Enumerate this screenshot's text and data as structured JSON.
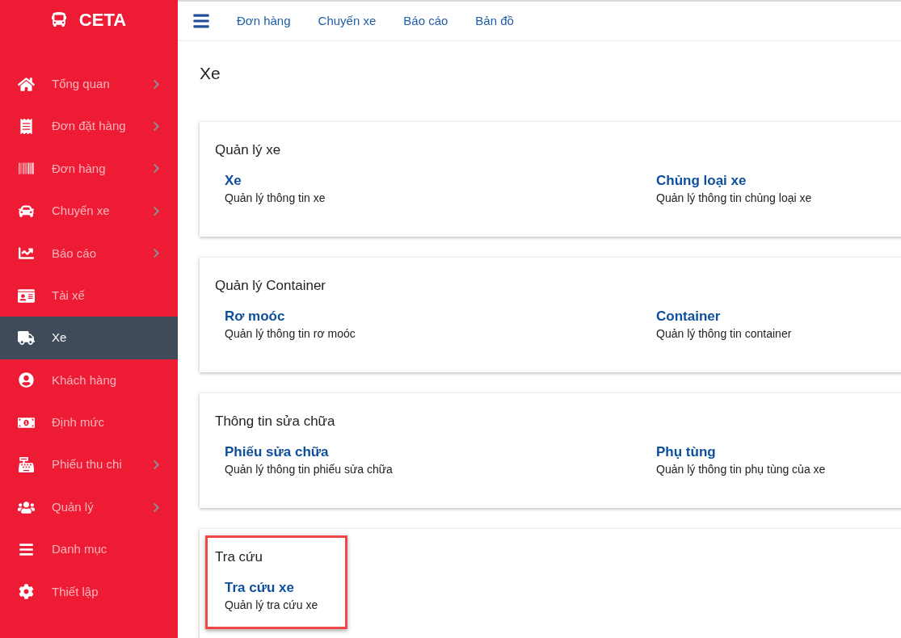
{
  "sidebar": {
    "logo": "CETA",
    "items": [
      {
        "label": "Tổng quan",
        "selected": false,
        "has_submenu": true
      },
      {
        "label": "Đơn đặt hàng",
        "selected": false,
        "has_submenu": true
      },
      {
        "label": "Đơn hàng",
        "selected": false,
        "has_submenu": true
      },
      {
        "label": "Chuyến xe",
        "selected": false,
        "has_submenu": true
      },
      {
        "label": "Báo cáo",
        "selected": false,
        "has_submenu": true
      },
      {
        "label": "Tài xế",
        "selected": false,
        "has_submenu": false
      },
      {
        "label": "Xe",
        "selected": true,
        "has_submenu": false
      },
      {
        "label": "Khách hàng",
        "selected": false,
        "has_submenu": false
      },
      {
        "label": "Định mức",
        "selected": false,
        "has_submenu": false
      },
      {
        "label": "Phiếu thu chi",
        "selected": false,
        "has_submenu": true
      },
      {
        "label": "Quản lý",
        "selected": false,
        "has_submenu": true
      },
      {
        "label": "Danh mục",
        "selected": false,
        "has_submenu": false
      },
      {
        "label": "Thiết lập",
        "selected": false,
        "has_submenu": false
      }
    ]
  },
  "top_nav": {
    "links": [
      "Đơn hàng",
      "Chuyến xe",
      "Báo cáo",
      "Bản đồ"
    ]
  },
  "page_title": "Xe",
  "sections": [
    {
      "title": "Quản lý xe",
      "highlighted": false,
      "items": [
        {
          "title": "Xe",
          "description": "Quản lý thông tin xe"
        },
        {
          "title": "Chủng loại xe",
          "description": "Quản lý thông tin chủng loại xe"
        }
      ]
    },
    {
      "title": "Quản lý Container",
      "highlighted": false,
      "items": [
        {
          "title": "Rơ moóc",
          "description": "Quản lý thông tin rơ moóc"
        },
        {
          "title": "Container",
          "description": "Quản lý thông tin container"
        }
      ]
    },
    {
      "title": "Thông tin sửa chữa",
      "highlighted": false,
      "items": [
        {
          "title": "Phiếu sửa chữa",
          "description": "Quản lý thông tin phiếu sửa chữa"
        },
        {
          "title": "Phụ tùng",
          "description": "Quản lý thông tin phụ tùng của xe"
        }
      ]
    },
    {
      "title": "Tra cứu",
      "highlighted": true,
      "items": [
        {
          "title": "Tra cứu xe",
          "description": "Quản lý tra cứu xe"
        }
      ]
    }
  ]
}
